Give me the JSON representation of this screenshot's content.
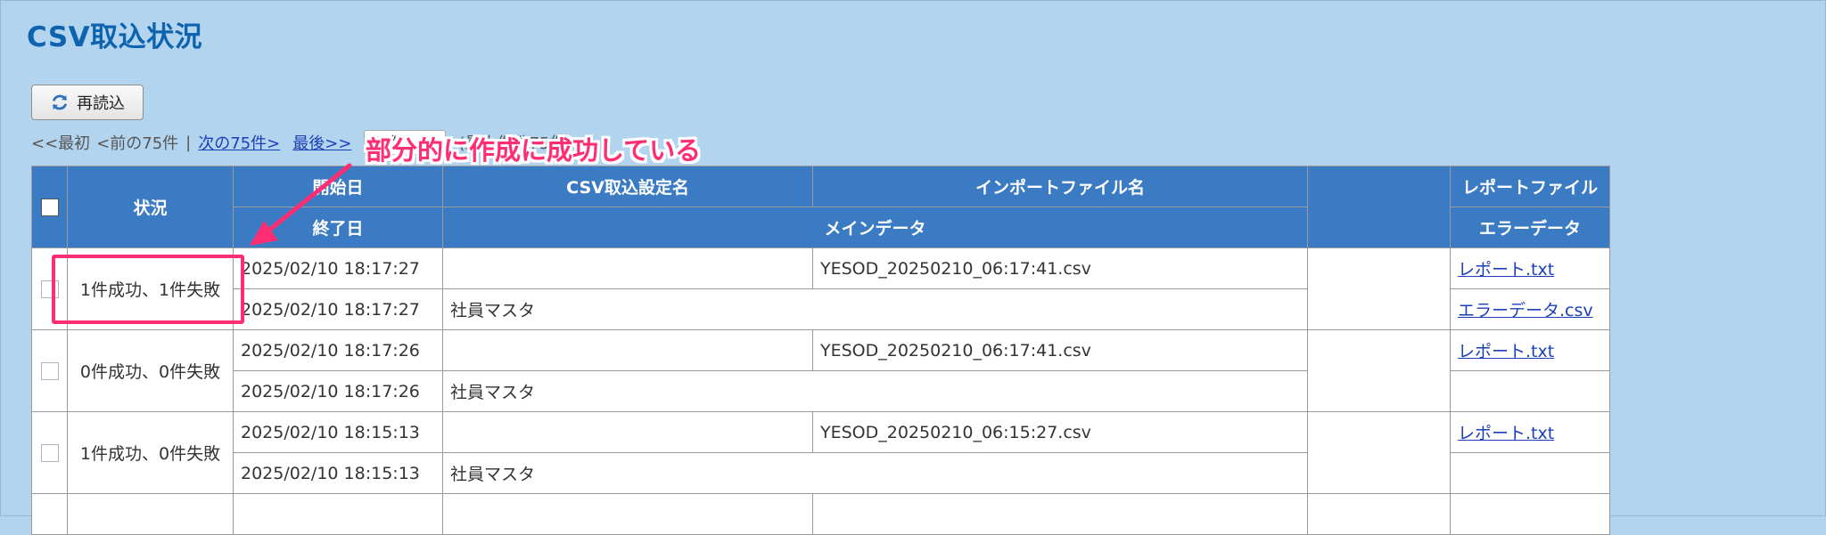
{
  "page": {
    "title": "CSV取込状況"
  },
  "toolbar": {
    "reload_label": "再読込"
  },
  "pager": {
    "first": "<<最初",
    "prev": "<前の75件",
    "separator": "|",
    "next": "次の75件>",
    "last": "最後>>",
    "per_page": "75件",
    "note": "(最大件数75件)"
  },
  "table": {
    "headers": {
      "status": "状況",
      "start_date": "開始日",
      "setting_name": "CSV取込設定名",
      "import_file": "インポートファイル名",
      "report_file": "レポートファイル",
      "end_date": "終了日",
      "main_data": "メインデータ",
      "error_data": "エラーデータ"
    },
    "rows": [
      {
        "status": "1件成功、1件失敗",
        "start": "2025/02/10 18:17:27",
        "setting_name": "",
        "file": "YESOD_20250210_06:17:41.csv",
        "end": "2025/02/10 18:17:27",
        "main_data": "社員マスタ",
        "report": "レポート.txt",
        "error": "エラーデータ.csv"
      },
      {
        "status": "0件成功、0件失敗",
        "start": "2025/02/10 18:17:26",
        "setting_name": "",
        "file": "YESOD_20250210_06:17:41.csv",
        "end": "2025/02/10 18:17:26",
        "main_data": "社員マスタ",
        "report": "レポート.txt",
        "error": ""
      },
      {
        "status": "1件成功、0件失敗",
        "start": "2025/02/10 18:15:13",
        "setting_name": "",
        "file": "YESOD_20250210_06:15:27.csv",
        "end": "2025/02/10 18:15:13",
        "main_data": "社員マスタ",
        "report": "レポート.txt",
        "error": ""
      }
    ]
  },
  "annotation": {
    "text": "部分的に作成に成功している",
    "color": "#ff2d71"
  },
  "colors": {
    "background": "#b3d4ef",
    "header": "#3a7bc4",
    "title": "#0d63ad",
    "link": "#1a3fb8"
  }
}
